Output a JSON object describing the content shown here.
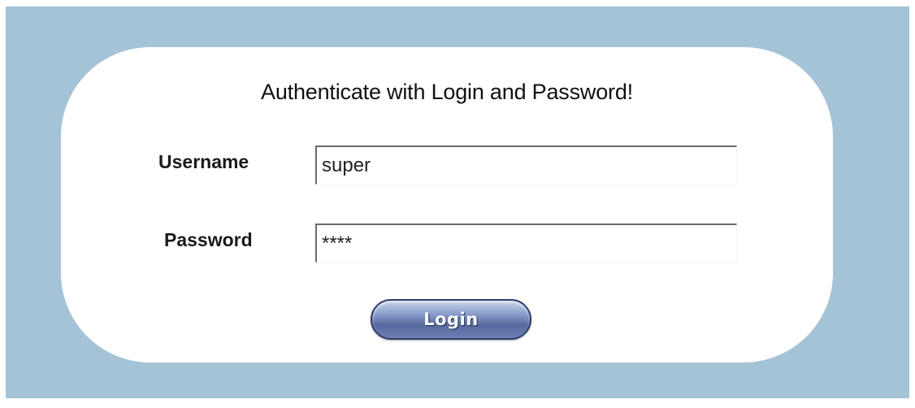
{
  "login_form": {
    "title": "Authenticate with Login and Password!",
    "username": {
      "label": "Username",
      "value": "super"
    },
    "password": {
      "label": "Password",
      "value": "****"
    },
    "login_button_label": "Login"
  },
  "colors": {
    "background": "#a5c3d6",
    "card": "#ffffff",
    "button": "#56699f"
  }
}
